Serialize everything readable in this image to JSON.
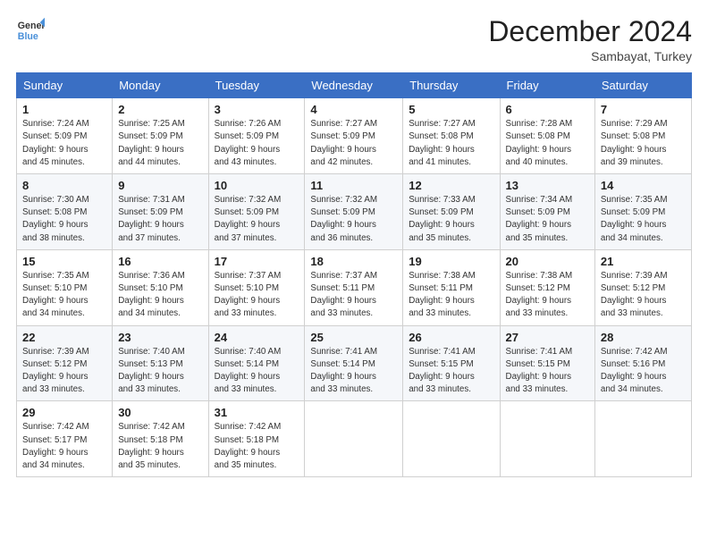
{
  "header": {
    "logo_line1": "General",
    "logo_line2": "Blue",
    "month_title": "December 2024",
    "subtitle": "Sambayat, Turkey"
  },
  "days_of_week": [
    "Sunday",
    "Monday",
    "Tuesday",
    "Wednesday",
    "Thursday",
    "Friday",
    "Saturday"
  ],
  "weeks": [
    [
      {
        "day": 1,
        "info": "Sunrise: 7:24 AM\nSunset: 5:09 PM\nDaylight: 9 hours\nand 45 minutes."
      },
      {
        "day": 2,
        "info": "Sunrise: 7:25 AM\nSunset: 5:09 PM\nDaylight: 9 hours\nand 44 minutes."
      },
      {
        "day": 3,
        "info": "Sunrise: 7:26 AM\nSunset: 5:09 PM\nDaylight: 9 hours\nand 43 minutes."
      },
      {
        "day": 4,
        "info": "Sunrise: 7:27 AM\nSunset: 5:09 PM\nDaylight: 9 hours\nand 42 minutes."
      },
      {
        "day": 5,
        "info": "Sunrise: 7:27 AM\nSunset: 5:08 PM\nDaylight: 9 hours\nand 41 minutes."
      },
      {
        "day": 6,
        "info": "Sunrise: 7:28 AM\nSunset: 5:08 PM\nDaylight: 9 hours\nand 40 minutes."
      },
      {
        "day": 7,
        "info": "Sunrise: 7:29 AM\nSunset: 5:08 PM\nDaylight: 9 hours\nand 39 minutes."
      }
    ],
    [
      {
        "day": 8,
        "info": "Sunrise: 7:30 AM\nSunset: 5:08 PM\nDaylight: 9 hours\nand 38 minutes."
      },
      {
        "day": 9,
        "info": "Sunrise: 7:31 AM\nSunset: 5:09 PM\nDaylight: 9 hours\nand 37 minutes."
      },
      {
        "day": 10,
        "info": "Sunrise: 7:32 AM\nSunset: 5:09 PM\nDaylight: 9 hours\nand 37 minutes."
      },
      {
        "day": 11,
        "info": "Sunrise: 7:32 AM\nSunset: 5:09 PM\nDaylight: 9 hours\nand 36 minutes."
      },
      {
        "day": 12,
        "info": "Sunrise: 7:33 AM\nSunset: 5:09 PM\nDaylight: 9 hours\nand 35 minutes."
      },
      {
        "day": 13,
        "info": "Sunrise: 7:34 AM\nSunset: 5:09 PM\nDaylight: 9 hours\nand 35 minutes."
      },
      {
        "day": 14,
        "info": "Sunrise: 7:35 AM\nSunset: 5:09 PM\nDaylight: 9 hours\nand 34 minutes."
      }
    ],
    [
      {
        "day": 15,
        "info": "Sunrise: 7:35 AM\nSunset: 5:10 PM\nDaylight: 9 hours\nand 34 minutes."
      },
      {
        "day": 16,
        "info": "Sunrise: 7:36 AM\nSunset: 5:10 PM\nDaylight: 9 hours\nand 34 minutes."
      },
      {
        "day": 17,
        "info": "Sunrise: 7:37 AM\nSunset: 5:10 PM\nDaylight: 9 hours\nand 33 minutes."
      },
      {
        "day": 18,
        "info": "Sunrise: 7:37 AM\nSunset: 5:11 PM\nDaylight: 9 hours\nand 33 minutes."
      },
      {
        "day": 19,
        "info": "Sunrise: 7:38 AM\nSunset: 5:11 PM\nDaylight: 9 hours\nand 33 minutes."
      },
      {
        "day": 20,
        "info": "Sunrise: 7:38 AM\nSunset: 5:12 PM\nDaylight: 9 hours\nand 33 minutes."
      },
      {
        "day": 21,
        "info": "Sunrise: 7:39 AM\nSunset: 5:12 PM\nDaylight: 9 hours\nand 33 minutes."
      }
    ],
    [
      {
        "day": 22,
        "info": "Sunrise: 7:39 AM\nSunset: 5:12 PM\nDaylight: 9 hours\nand 33 minutes."
      },
      {
        "day": 23,
        "info": "Sunrise: 7:40 AM\nSunset: 5:13 PM\nDaylight: 9 hours\nand 33 minutes."
      },
      {
        "day": 24,
        "info": "Sunrise: 7:40 AM\nSunset: 5:14 PM\nDaylight: 9 hours\nand 33 minutes."
      },
      {
        "day": 25,
        "info": "Sunrise: 7:41 AM\nSunset: 5:14 PM\nDaylight: 9 hours\nand 33 minutes."
      },
      {
        "day": 26,
        "info": "Sunrise: 7:41 AM\nSunset: 5:15 PM\nDaylight: 9 hours\nand 33 minutes."
      },
      {
        "day": 27,
        "info": "Sunrise: 7:41 AM\nSunset: 5:15 PM\nDaylight: 9 hours\nand 33 minutes."
      },
      {
        "day": 28,
        "info": "Sunrise: 7:42 AM\nSunset: 5:16 PM\nDaylight: 9 hours\nand 34 minutes."
      }
    ],
    [
      {
        "day": 29,
        "info": "Sunrise: 7:42 AM\nSunset: 5:17 PM\nDaylight: 9 hours\nand 34 minutes."
      },
      {
        "day": 30,
        "info": "Sunrise: 7:42 AM\nSunset: 5:18 PM\nDaylight: 9 hours\nand 35 minutes."
      },
      {
        "day": 31,
        "info": "Sunrise: 7:42 AM\nSunset: 5:18 PM\nDaylight: 9 hours\nand 35 minutes."
      },
      null,
      null,
      null,
      null
    ]
  ]
}
